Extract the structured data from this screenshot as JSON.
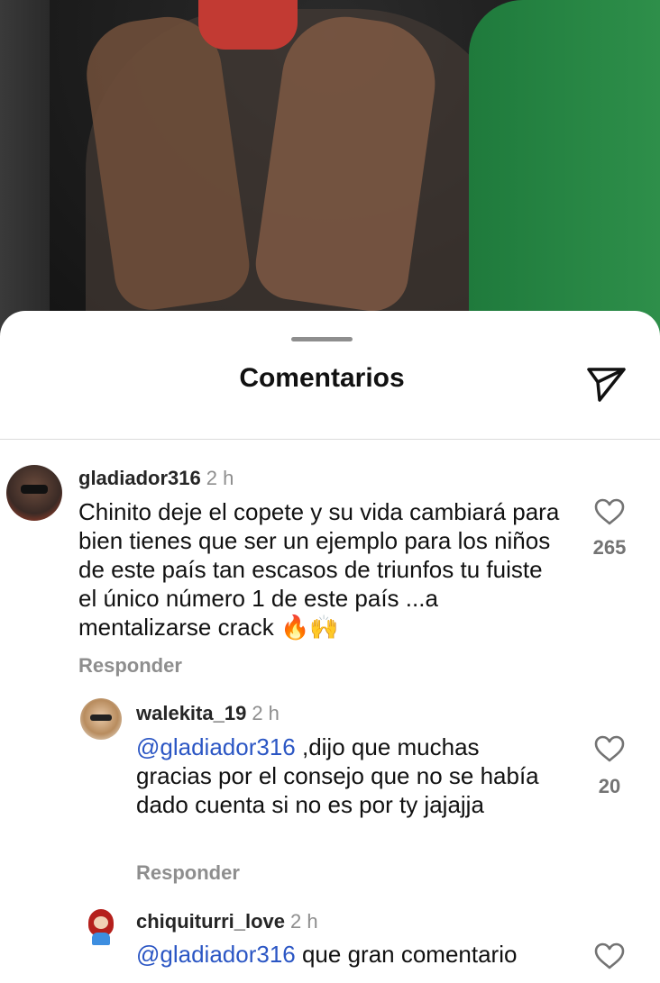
{
  "sheet": {
    "title": "Comentarios"
  },
  "comments": [
    {
      "username": "gladiador316",
      "time": "2 h",
      "text": "Chinito deje el copete y su vida cambiará para bien tienes que ser un ejemplo para los niños de este país tan escasos de triunfos tu fuiste el único número 1 de este país ...a mentalizarse crack 🔥🙌",
      "likes": "265",
      "reply_label": "Responder"
    },
    {
      "username": "walekita_19",
      "time": "2 h",
      "mention": "@gladiador316",
      "text": " ,dijo que muchas gracias por el consejo que no se había dado cuenta si no es por ty jajajja",
      "likes": "20",
      "reply_label": "Responder"
    },
    {
      "username": "chiquiturri_love",
      "time": "2 h",
      "mention": "@gladiador316",
      "text": " que gran comentario"
    }
  ],
  "icons": {
    "send": "paper-plane-icon",
    "like": "heart-outline-icon"
  }
}
